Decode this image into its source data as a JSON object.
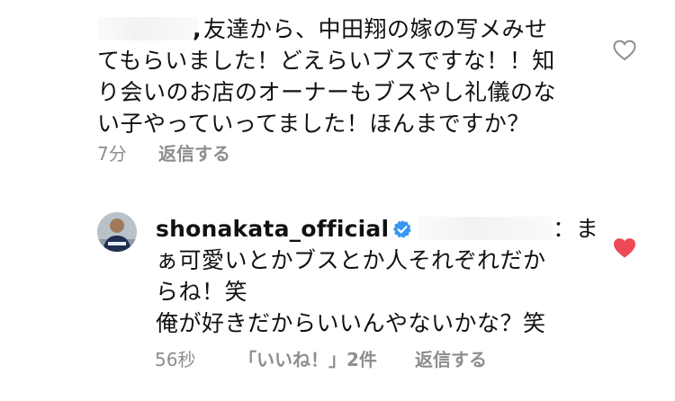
{
  "comments": [
    {
      "lines": [
        "友達から、中田翔の嫁の写メみせ",
        "てもらいました！どえらいブスですな！！知",
        "り会いのお店のオーナーもブスやし礼儀のな",
        "い子やっていってました！ほんまですか？"
      ],
      "time": "7分",
      "reply_label": "返信する",
      "liked": false
    },
    {
      "username": "shonakata_official",
      "verified": true,
      "lines": [
        "：ま",
        "ぁ可愛いとかブスとか人それぞれだか",
        "らね！笑",
        "俺が好きだからいいんやないかな？笑"
      ],
      "time": "56秒",
      "likes_label": "「いいね！」2件",
      "reply_label": "返信する",
      "liked": true
    }
  ],
  "colors": {
    "text": "#111111",
    "meta": "#8e8e8e",
    "like_red": "#ed4956",
    "verified_blue": "#3897f0"
  }
}
